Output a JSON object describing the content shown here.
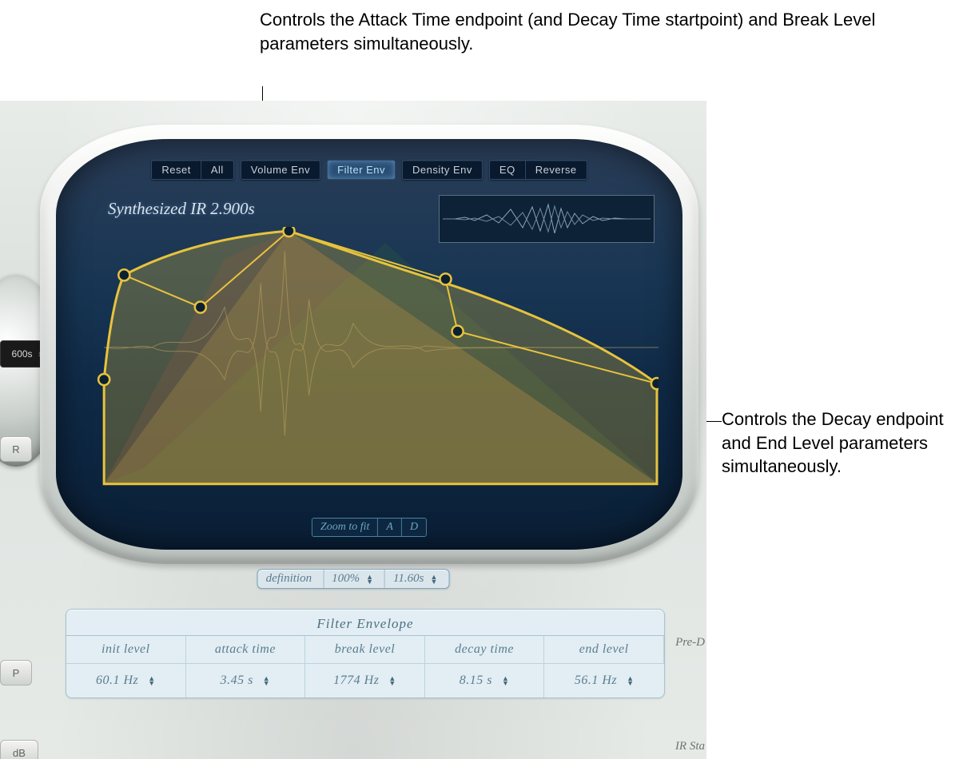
{
  "annotations": {
    "top": "Controls the Attack Time endpoint (and Decay Time startpoint) and Break Level parameters simultaneously.",
    "right": "Controls the Decay endpoint and End Level parameters simultaneously."
  },
  "toolbar": {
    "reset": "Reset",
    "all": "All",
    "volume_env": "Volume Env",
    "filter_env": "Filter Env",
    "density_env": "Density Env",
    "eq": "EQ",
    "reverse": "Reverse"
  },
  "display": {
    "title": "Synthesized IR 2.900s",
    "zoom_to_fit": "Zoom to fit",
    "zoom_a": "A",
    "zoom_d": "D"
  },
  "definition": {
    "label": "definition",
    "percent": "100%",
    "time": "11.60s"
  },
  "filter_envelope": {
    "title": "Filter Envelope",
    "headers": {
      "init_level": "init level",
      "attack_time": "attack time",
      "break_level": "break level",
      "decay_time": "decay time",
      "end_level": "end level"
    },
    "values": {
      "init_level": "60.1 Hz",
      "attack_time": "3.45 s",
      "break_level": "1774 Hz",
      "decay_time": "8.15 s",
      "end_level": "56.1 Hz"
    }
  },
  "side": {
    "readout": "600s",
    "btn_r": "R",
    "btn_hp": "P",
    "btn_db": "dB",
    "pre_label": "Pre-D",
    "ir_label": "IR Sta"
  }
}
